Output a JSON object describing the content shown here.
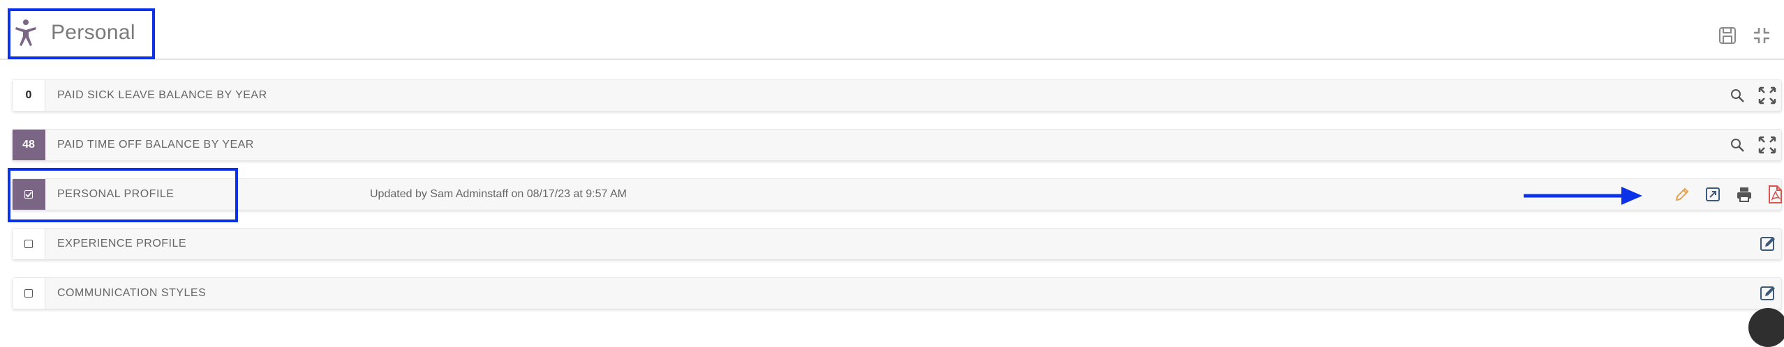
{
  "header": {
    "title": "Personal",
    "icons": {
      "section": "person-icon",
      "save": "save-icon",
      "collapse": "collapse-icon"
    }
  },
  "rows": [
    {
      "badge": "0",
      "badge_style": "outline",
      "label": "PAID SICK LEAVE BALANCE BY YEAR",
      "updated": "",
      "actions": [
        "search-icon",
        "expand-icon"
      ]
    },
    {
      "badge": "48",
      "badge_style": "filled",
      "label": "PAID TIME OFF BALANCE BY YEAR",
      "updated": "",
      "actions": [
        "search-icon",
        "expand-icon"
      ]
    },
    {
      "badge": "checked",
      "badge_style": "filled",
      "label": "PERSONAL PROFILE",
      "updated": "Updated by Sam Adminstaff on 08/17/23 at 9:57 AM",
      "actions": [
        "edit-pencil-icon",
        "open-external-icon",
        "print-icon",
        "pdf-icon"
      ]
    },
    {
      "badge": "unchecked",
      "badge_style": "outline",
      "label": "EXPERIENCE PROFILE",
      "updated": "",
      "actions": [
        "edit-form-icon"
      ]
    },
    {
      "badge": "unchecked",
      "badge_style": "outline",
      "label": "COMMUNICATION STYLES",
      "updated": "",
      "actions": [
        "edit-form-icon"
      ]
    }
  ],
  "colors": {
    "accent_purple": "#7a6585",
    "highlight_blue": "#0c32e8",
    "edit_orange": "#e8a24b",
    "pdf_red": "#d9534f",
    "icon_gray": "#555555",
    "edit_blue": "#3d5a7a"
  }
}
